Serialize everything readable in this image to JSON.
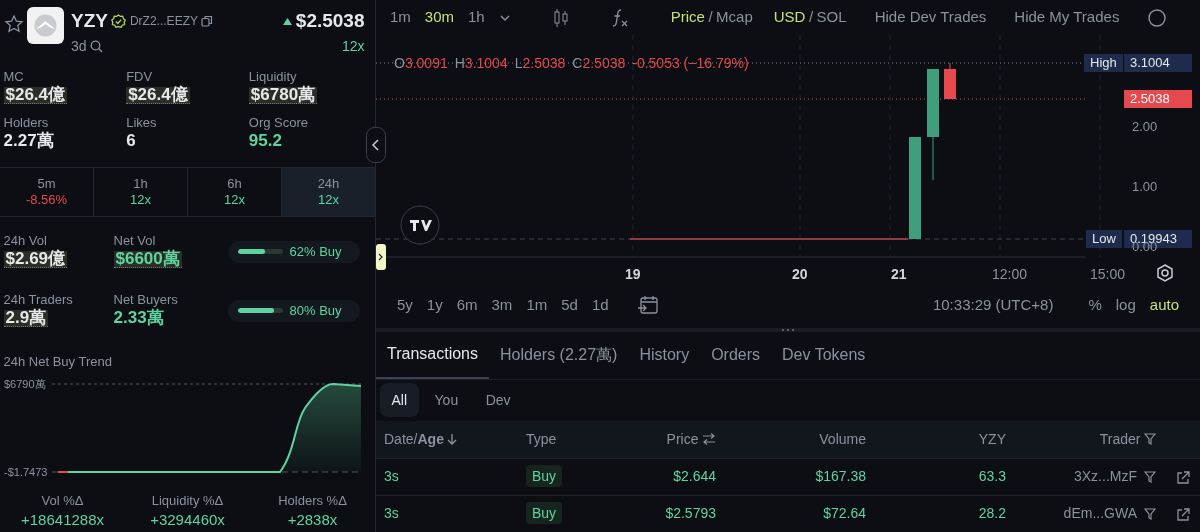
{
  "token": {
    "symbol": "YZY",
    "address": "DrZ2...EEZY",
    "age": "3d",
    "price": "$2.5038",
    "multiplier": "12x",
    "favorite": false
  },
  "stats": [
    {
      "label": "MC",
      "value": "$26.4億",
      "highlight": true,
      "positive": false
    },
    {
      "label": "FDV",
      "value": "$26.4億",
      "highlight": true,
      "positive": false
    },
    {
      "label": "Liquidity",
      "value": "$6780萬",
      "highlight": true,
      "positive": false
    },
    {
      "label": "Holders",
      "value": "2.27萬",
      "highlight": false,
      "positive": false
    },
    {
      "label": "Likes",
      "value": "6",
      "highlight": false,
      "positive": false
    },
    {
      "label": "Org Score",
      "value": "95.2",
      "highlight": false,
      "positive": true
    }
  ],
  "timeframes": [
    {
      "label": "5m",
      "value": "-8.56%",
      "positive": false,
      "selected": false
    },
    {
      "label": "1h",
      "value": "12x",
      "positive": true,
      "selected": false
    },
    {
      "label": "6h",
      "value": "12x",
      "positive": true,
      "selected": false
    },
    {
      "label": "24h",
      "value": "12x",
      "positive": true,
      "selected": true
    }
  ],
  "flow_rows": [
    {
      "left": {
        "label": "24h Vol",
        "value": "$2.69億",
        "highlight": true,
        "positive": false
      },
      "right": {
        "label": "Net Vol",
        "value": "$6600萬",
        "highlight": true,
        "positive": true
      },
      "meter": {
        "level": 0.62,
        "label": "62% Buy"
      }
    },
    {
      "left": {
        "label": "24h Traders",
        "value": "2.9萬",
        "highlight": true,
        "positive": false
      },
      "right": {
        "label": "Net Buyers",
        "value": "2.33萬",
        "highlight": false,
        "positive": true
      },
      "meter": {
        "level": 0.8,
        "label": "80% Buy"
      }
    }
  ],
  "trend": {
    "title": "24h Net Buy Trend",
    "max_label": "$6790萬",
    "min_label": "-$1.7473"
  },
  "deltas": [
    {
      "label": "Vol %Δ",
      "value": "+18641288x"
    },
    {
      "label": "Liquidity %Δ",
      "value": "+3294460x"
    },
    {
      "label": "Holders %Δ",
      "value": "+2838x"
    }
  ],
  "toolbar": {
    "intervals": [
      {
        "label": "1m",
        "selected": false
      },
      {
        "label": "30m",
        "selected": true
      },
      {
        "label": "1h",
        "selected": false
      }
    ],
    "toggles": [
      {
        "separator": "/",
        "options": [
          {
            "label": "Price",
            "selected": true
          },
          {
            "label": "Mcap",
            "selected": false
          }
        ]
      },
      {
        "separator": "/",
        "options": [
          {
            "label": "USD",
            "selected": true
          },
          {
            "label": "SOL",
            "selected": false
          }
        ]
      }
    ],
    "actions": [
      "Hide Dev Trades",
      "Hide My Trades"
    ]
  },
  "legend": [
    {
      "key": "O",
      "value": "3.0091"
    },
    {
      "key": "H",
      "value": "3.1004"
    },
    {
      "key": "L",
      "value": "2.5038"
    },
    {
      "key": "C",
      "value": "2.5038"
    }
  ],
  "legend_change": "-0.5053 (−16.79%)",
  "price_tags": {
    "high_label": "High",
    "high_value": "3.1004",
    "last": "2.5038",
    "low_label": "Low",
    "low_value": "0.19943"
  },
  "y_axis": [
    "2.00",
    "1.00",
    "0.00"
  ],
  "x_axis": [
    {
      "label": "19",
      "bold": true
    },
    {
      "label": "20",
      "bold": true
    },
    {
      "label": "21",
      "bold": true
    },
    {
      "label": "12:00",
      "bold": false
    },
    {
      "label": "15:00",
      "bold": false
    }
  ],
  "ranges": [
    "5y",
    "1y",
    "6m",
    "3m",
    "1m",
    "5d",
    "1d"
  ],
  "clock": "10:33:29 (UTC+8)",
  "scale_options": [
    {
      "label": "%",
      "selected": false
    },
    {
      "label": "log",
      "selected": false
    },
    {
      "label": "auto",
      "selected": true
    }
  ],
  "tabs": [
    {
      "label": "Transactions",
      "selected": true
    },
    {
      "label": "Holders (2.27萬)",
      "selected": false
    },
    {
      "label": "History",
      "selected": false
    },
    {
      "label": "Orders",
      "selected": false
    },
    {
      "label": "Dev Tokens",
      "selected": false
    }
  ],
  "filters": [
    {
      "label": "All",
      "selected": true
    },
    {
      "label": "You",
      "selected": false
    },
    {
      "label": "Dev",
      "selected": false
    }
  ],
  "table": {
    "columns": [
      "Date/**Age**",
      "Type",
      "Price",
      "Volume",
      "YZY",
      "Trader"
    ],
    "rows": [
      {
        "age": "3s",
        "type": "Buy",
        "price": "$2.644",
        "volume": "$167.38",
        "amount": "63.3",
        "trader": "3Xz...MzF"
      },
      {
        "age": "3s",
        "type": "Buy",
        "price": "$2.5793",
        "volume": "$72.64",
        "amount": "28.2",
        "trader": "dEm...GWA"
      }
    ]
  }
}
